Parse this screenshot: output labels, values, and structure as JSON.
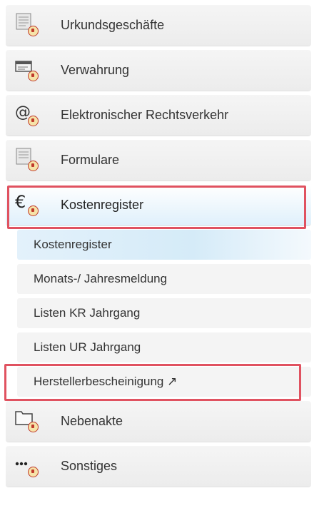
{
  "menu": {
    "items": [
      {
        "label": "Urkundsgeschäfte",
        "icon": "document-icon"
      },
      {
        "label": "Verwahrung",
        "icon": "card-icon"
      },
      {
        "label": "Elektronischer Rechtsverkehr",
        "icon": "at-icon"
      },
      {
        "label": "Formulare",
        "icon": "form-icon"
      },
      {
        "label": "Kostenregister",
        "icon": "euro-icon"
      }
    ],
    "subitems": [
      {
        "label": "Kostenregister"
      },
      {
        "label": "Monats-/ Jahresmeldung"
      },
      {
        "label": "Listen KR Jahrgang"
      },
      {
        "label": "Listen UR Jahrgang"
      },
      {
        "label": "Herstellerbescheinigung ↗"
      }
    ],
    "items_after": [
      {
        "label": "Nebenakte",
        "icon": "folder-icon"
      },
      {
        "label": "Sonstiges",
        "icon": "more-icon"
      }
    ]
  },
  "colors": {
    "highlight": "#e05260",
    "active_bg": "#dff0fb",
    "item_bg": "#efefef"
  }
}
